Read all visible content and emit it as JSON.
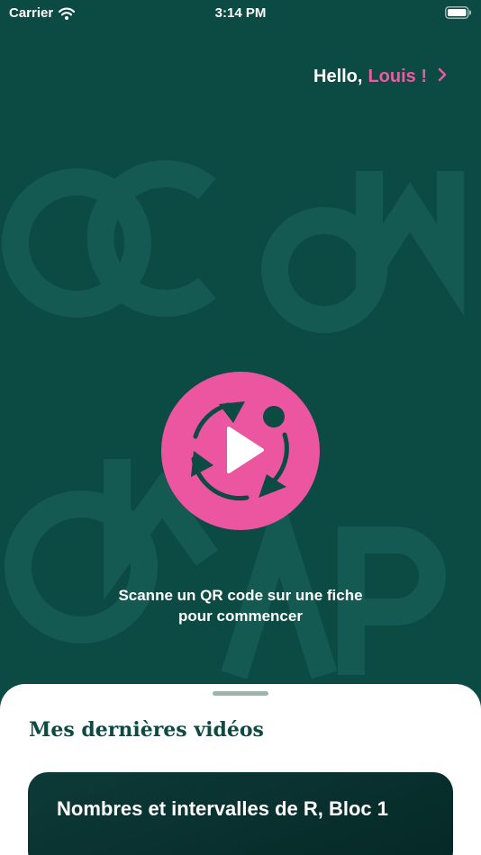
{
  "status_bar": {
    "carrier": "Carrier",
    "time": "3:14 PM"
  },
  "header": {
    "greeting": "Hello,",
    "user_name": "Louis !"
  },
  "main": {
    "instruction_line1": "Scanne un QR code sur une fiche",
    "instruction_line2": "pour commencer"
  },
  "sheet": {
    "title": "Mes dernières vidéos",
    "videos": [
      {
        "title": "Nombres et intervalles de R, Bloc 1"
      }
    ]
  },
  "colors": {
    "background": "#0c4a44",
    "accent": "#ec559f",
    "logo_watermark": "#155a52",
    "sheet": "#ffffff",
    "card": "#052826"
  }
}
